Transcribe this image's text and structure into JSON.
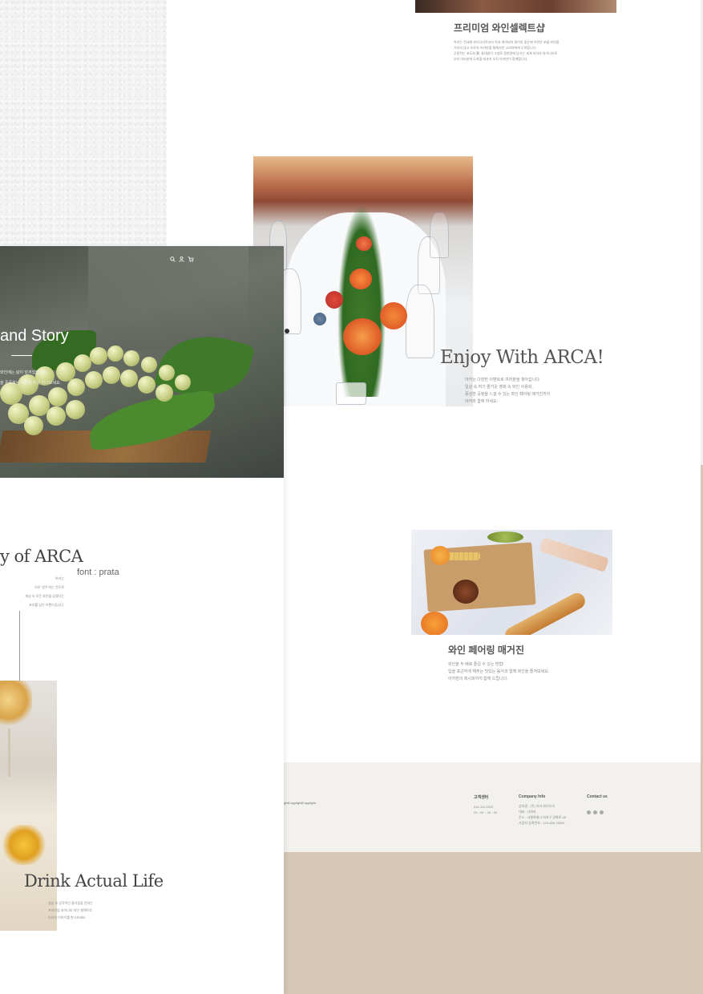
{
  "premium": {
    "title": "프리미엄 와인셀렉트샵",
    "desc": [
      "아카는 전세계 와이너리로부터 독과 계약되어 질이의 좋은에 어떤은 포몰 와인을",
      "거치지 않고 오로지 아카만을 통해서만 소비자에게 도착합니다",
      "무원적는 포도와 夢, 들내용이 그대로 정한명에 담기는 세계 처자의 와이너리로",
      "부터 아라분화 도착을 대과지 오직 아카만이 함께합니다."
    ]
  },
  "enjoy": {
    "title": "Enjoy With ARCA!",
    "desc": [
      "아카는 다양한 이벤트로 여러분을 찾아갑니다.",
      "일상 속 여기 즐거운 영화 속 와인 사용회,",
      "풍성한 공정을 느낄 수 있는 와인 페어링 매거진까지",
      "아카와 함께 하세요."
    ]
  },
  "pairing": {
    "title": "와인 페어링 매거진",
    "desc": [
      "와인을 두 배로 즐길 수 있는 방법!",
      "입을 포근하게 해주는 맛있는 음식과 함께 와인을 즐겨보세요.",
      "아카만의 레시피까지 함께 드립니다."
    ]
  },
  "footer": {
    "copyright": "ghtCopyrightCopyright",
    "customer_center": {
      "title": "고객센터",
      "lines": [
        "031-111-2222",
        "09 : 00 ~ 18 : 00"
      ]
    },
    "company_info": {
      "title": "Company Info",
      "lines": [
        "상호명 : (주) 아카 와이너리",
        "대표 : 나와카",
        "주소 : 서울특별시 마포구 양화로 45",
        "사업자 등록번호 : 123-456-78900"
      ]
    },
    "contact": {
      "title": "Contact us"
    }
  },
  "hero": {
    "title": "and Story",
    "desc": [
      "와인에는 삶이 담겨있습니다.",
      "을 존중하는 아카를 지금 만나보세요."
    ],
    "icons": [
      "search-icon",
      "user-icon",
      "cart-icon"
    ]
  },
  "story": {
    "title": "y of ARCA",
    "font_note": "font : prata",
    "desc": [
      "아카는",
      "으로 '방주'라는 뜻으로",
      "세상 속 모든 와인을 담겠다는",
      "포부를 담은 브랜드입니다."
    ]
  },
  "drink": {
    "title": "Drink Actual Life",
    "desc": [
      "일상 속 감각적인 즐거움을 전하는",
      "프리미엄 와이너리 와인 셀렉트로,",
      "아카의 이야기를 만나보세요."
    ]
  },
  "colors": {
    "background": "#d5c6b6",
    "footer": "#f2f1ed",
    "paper": "#f3f3f3"
  }
}
